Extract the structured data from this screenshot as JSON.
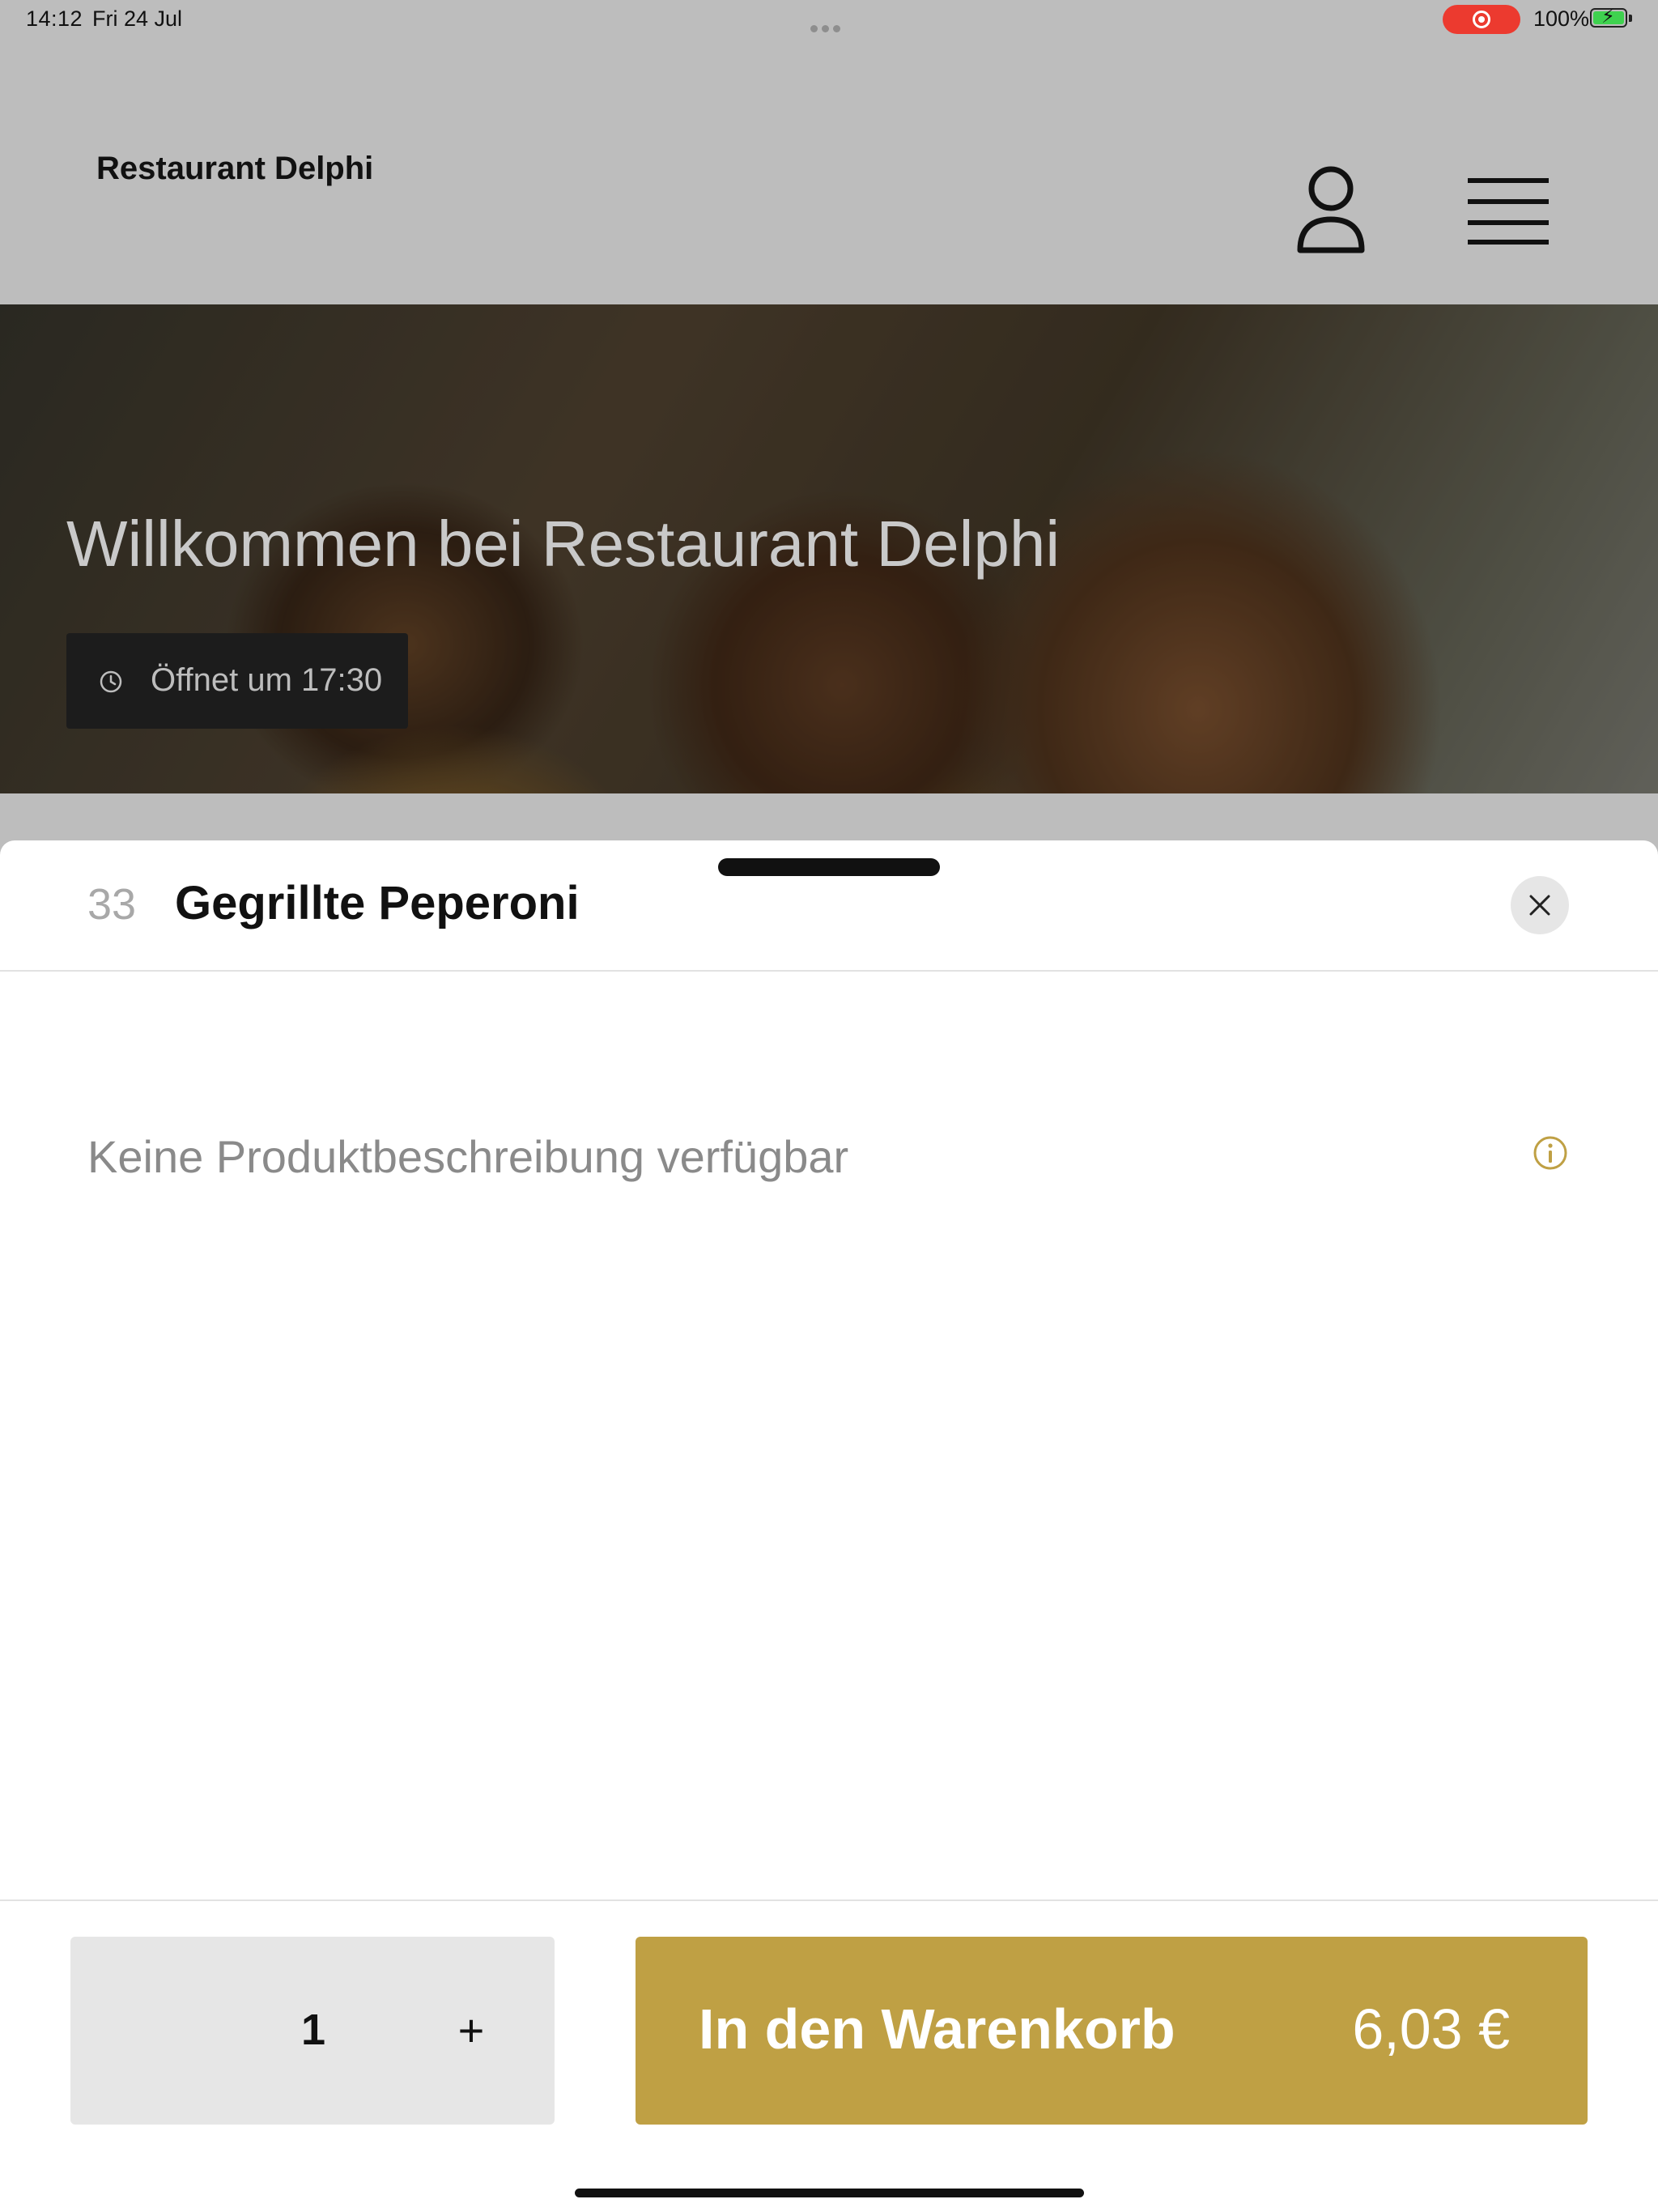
{
  "status_bar": {
    "time": "14:12",
    "date": "Fri 24 Jul",
    "battery": "100%"
  },
  "header": {
    "brand": "Restaurant Delphi",
    "icons": [
      "user-icon",
      "menu-icon"
    ]
  },
  "hero": {
    "title": "Willkommen bei Restaurant Delphi",
    "opening": "Öffnet um 17:30"
  },
  "sheet": {
    "item_number": "33",
    "item_title": "Gegrillte Peperoni",
    "description": "Keine Produktbeschreibung verfügbar"
  },
  "footer": {
    "quantity": "1",
    "plus_label": "+",
    "cart_label": "In den Warenkorb",
    "price": "6,03 €"
  },
  "colors": {
    "accent": "#bfa044",
    "record": "#ec3a2f",
    "battery": "#3fd24f"
  }
}
